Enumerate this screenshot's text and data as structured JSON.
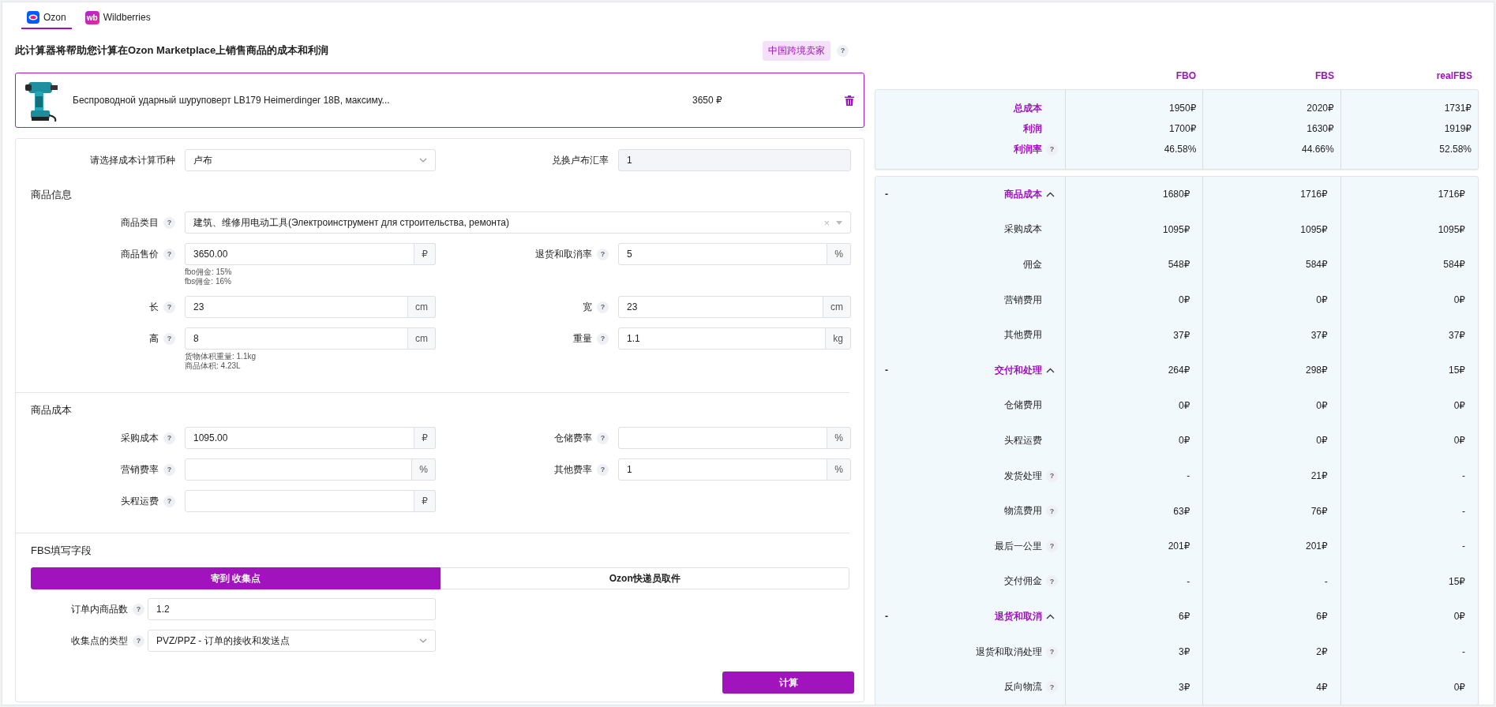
{
  "tabs": [
    {
      "label": "Ozon",
      "selected": true,
      "kind": "drawn-logo"
    },
    {
      "label": "Wildberries",
      "selected": false,
      "kind": "text-logo",
      "logo": "wb"
    }
  ],
  "intro": {
    "title": "此计算器将帮助您计算在Ozon Marketplace上销售商品的成本和利润",
    "badge": "中国跨境卖家",
    "help": "?"
  },
  "product": {
    "name": "Беспроводной ударный шуруповерт LB179 Heimerdinger 18В, максиму...",
    "price": "3650 ₽"
  },
  "form": {
    "currency": [
      {
        "kind": "select",
        "label": "请选择成本计算币种",
        "value": "卢布"
      },
      {
        "kind": "input",
        "label": "兑换卢布汇率",
        "value": "1",
        "disabled": true
      }
    ],
    "sections": [
      {
        "kind": "standard",
        "title": "商品信息",
        "rows": [
          [
            {
              "kind": "combobox",
              "label": "商品类目",
              "help": "?",
              "value": "建筑、维修用电动工具(Электроинструмент для строительства, ремонта)",
              "clear": "×"
            }
          ],
          [
            {
              "kind": "input",
              "label": "商品售价",
              "help": "?",
              "value": "3650.00",
              "unit": "₽",
              "notes": [
                "fbo佣金: 15%",
                "fbs佣金: 16%"
              ]
            },
            {
              "kind": "input",
              "label": "退货和取消率",
              "help": "?",
              "value": "5",
              "unit": "%"
            }
          ],
          [
            {
              "kind": "input",
              "label": "长",
              "help": "?",
              "value": "23",
              "unit": "cm"
            },
            {
              "kind": "input",
              "label": "宽",
              "help": "?",
              "value": "23",
              "unit": "cm"
            }
          ],
          [
            {
              "kind": "input",
              "label": "高",
              "help": "?",
              "value": "8",
              "unit": "cm",
              "notes": [
                "货物体积重量: 1.1kg",
                "商品体积: 4.23L"
              ]
            },
            {
              "kind": "input",
              "label": "重量",
              "help": "?",
              "value": "1.1",
              "unit": "kg"
            }
          ]
        ]
      },
      {
        "kind": "standard",
        "title": "商品成本",
        "rows": [
          [
            {
              "kind": "input",
              "label": "采购成本",
              "help": "?",
              "value": "1095.00",
              "unit": "₽"
            },
            {
              "kind": "input",
              "label": "仓储费率",
              "help": "?",
              "unit": "%"
            }
          ],
          [
            {
              "kind": "input",
              "label": "营销费率",
              "help": "?",
              "unit": "%"
            },
            {
              "kind": "input",
              "label": "其他费率",
              "help": "?",
              "value": "1",
              "unit": "%"
            }
          ],
          [
            {
              "kind": "input",
              "label": "头程运费",
              "help": "?",
              "unit": "₽"
            }
          ]
        ]
      },
      {
        "kind": "fbs",
        "title": "FBS填写字段",
        "modes": [
          {
            "label": "寄到 收集点",
            "selected": true
          },
          {
            "label": "Ozon快递员取件",
            "selected": false
          }
        ],
        "rows": [
          [
            {
              "kind": "input",
              "label": "订单内商品数",
              "help": "?",
              "value": "1.2"
            }
          ],
          [
            {
              "kind": "select",
              "label": "收集点的类型",
              "help": "?",
              "value": "PVZ/PPZ - 订单的接收和发送点"
            }
          ]
        ]
      }
    ],
    "submit": "计算"
  },
  "results": {
    "columns": [
      "FBO",
      "FBS",
      "realFBS"
    ],
    "summary": [
      {
        "label": "总成本",
        "values": [
          "1950₽",
          "2020₽",
          "1731₽"
        ]
      },
      {
        "label": "利润",
        "values": [
          "1700₽",
          "1630₽",
          "1919₽"
        ]
      },
      {
        "label": "利润率",
        "help": "?",
        "values": [
          "46.58%",
          "44.66%",
          "52.58%"
        ]
      }
    ],
    "details": [
      {
        "marker": "-",
        "label": "商品成本",
        "expanded": true,
        "values": [
          "1680₽",
          "1716₽",
          "1716₽"
        ],
        "children": [
          {
            "label": "采购成本",
            "values": [
              "1095₽",
              "1095₽",
              "1095₽"
            ]
          },
          {
            "label": "佣金",
            "values": [
              "548₽",
              "584₽",
              "584₽"
            ]
          },
          {
            "label": "营销费用",
            "values": [
              "0₽",
              "0₽",
              "0₽"
            ]
          },
          {
            "label": "其他费用",
            "values": [
              "37₽",
              "37₽",
              "37₽"
            ]
          }
        ]
      },
      {
        "marker": "-",
        "label": "交付和处理",
        "expanded": true,
        "values": [
          "264₽",
          "298₽",
          "15₽"
        ],
        "children": [
          {
            "label": "仓储费用",
            "values": [
              "0₽",
              "0₽",
              "0₽"
            ]
          },
          {
            "label": "头程运费",
            "values": [
              "0₽",
              "0₽",
              "0₽"
            ]
          },
          {
            "label": "发货处理",
            "help": "?",
            "values": [
              "-",
              "21₽",
              "-"
            ]
          },
          {
            "label": "物流费用",
            "help": "?",
            "values": [
              "63₽",
              "76₽",
              "-"
            ]
          },
          {
            "label": "最后一公里",
            "help": "?",
            "values": [
              "201₽",
              "201₽",
              "-"
            ]
          },
          {
            "label": "交付佣金",
            "help": "?",
            "values": [
              "-",
              "-",
              "15₽"
            ]
          }
        ]
      },
      {
        "marker": "-",
        "label": "退货和取消",
        "expanded": true,
        "values": [
          "6₽",
          "6₽",
          "0₽"
        ],
        "children": [
          {
            "label": "退货和取消处理",
            "help": "?",
            "values": [
              "3₽",
              "2₽",
              "-"
            ]
          },
          {
            "label": "反向物流",
            "help": "?",
            "values": [
              "3₽",
              "4₽",
              "0₽"
            ]
          }
        ]
      }
    ]
  }
}
